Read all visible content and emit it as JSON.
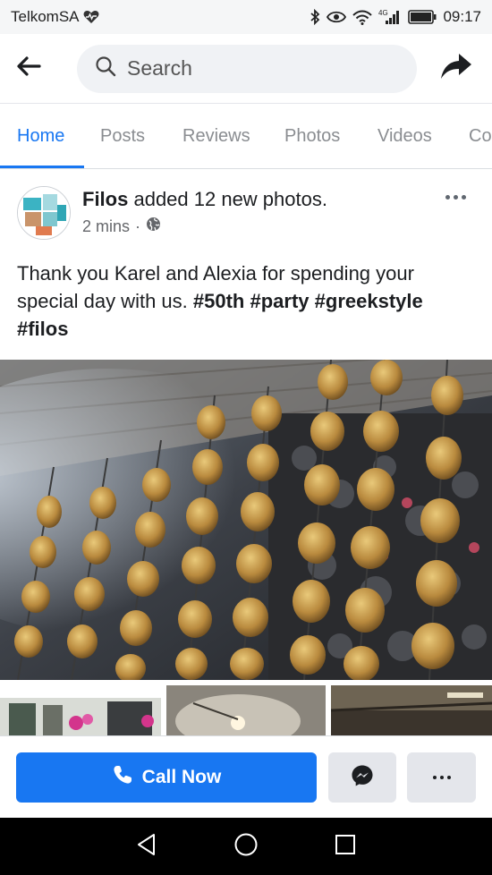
{
  "status_bar": {
    "carrier": "TelkomSA",
    "network": "4G",
    "time": "09:17",
    "icons": [
      "heart-pulse-icon",
      "bluetooth-icon",
      "eye-icon",
      "wifi-icon",
      "signal-icon",
      "battery-icon"
    ]
  },
  "header": {
    "back_icon": "arrow-left-icon",
    "search_placeholder": "Search",
    "share_icon": "share-arrow-icon"
  },
  "tabs": [
    {
      "label": "Home",
      "active": true
    },
    {
      "label": "Posts",
      "active": false
    },
    {
      "label": "Reviews",
      "active": false
    },
    {
      "label": "Photos",
      "active": false
    },
    {
      "label": "Videos",
      "active": false
    },
    {
      "label": "Co",
      "active": false
    }
  ],
  "post": {
    "page_name": "Filos",
    "action": "added 12 new photos.",
    "time": "2 mins",
    "separator": "·",
    "privacy_icon": "globe-icon",
    "text_plain": "Thank you Karel and Alexia for spending your special day with us.",
    "hashtags": [
      "#50th",
      "#party",
      "#greekstyle",
      "#filos"
    ]
  },
  "actions": {
    "call_label": "Call Now",
    "call_icon": "phone-icon",
    "messenger_icon": "messenger-icon",
    "more_icon": "more-horizontal-icon"
  },
  "colors": {
    "accent": "#1877f2",
    "button_secondary": "#e4e6eb",
    "text_secondary": "#65676b"
  }
}
